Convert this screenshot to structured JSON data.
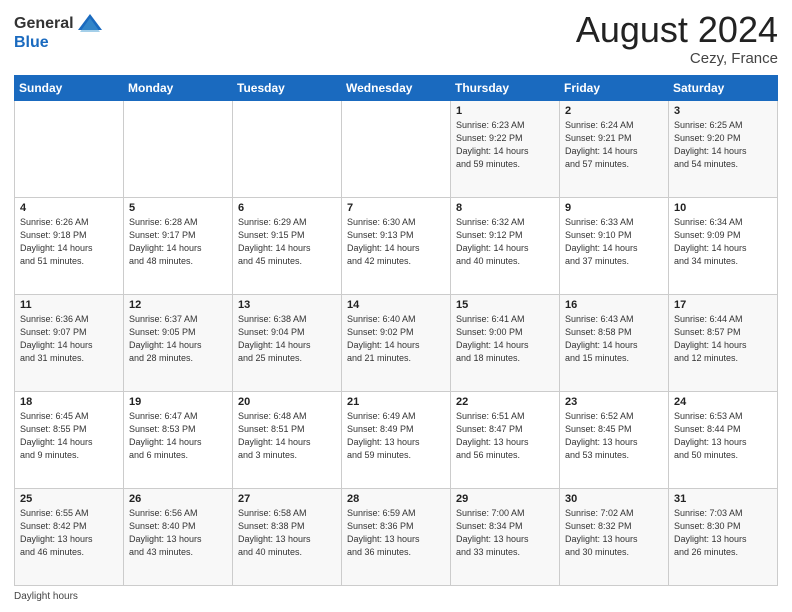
{
  "header": {
    "logo_general": "General",
    "logo_blue": "Blue",
    "month_year": "August 2024",
    "location": "Cezy, France"
  },
  "footer": {
    "daylight_label": "Daylight hours"
  },
  "weekdays": [
    "Sunday",
    "Monday",
    "Tuesday",
    "Wednesday",
    "Thursday",
    "Friday",
    "Saturday"
  ],
  "weeks": [
    [
      {
        "day": "",
        "info": ""
      },
      {
        "day": "",
        "info": ""
      },
      {
        "day": "",
        "info": ""
      },
      {
        "day": "",
        "info": ""
      },
      {
        "day": "1",
        "info": "Sunrise: 6:23 AM\nSunset: 9:22 PM\nDaylight: 14 hours\nand 59 minutes."
      },
      {
        "day": "2",
        "info": "Sunrise: 6:24 AM\nSunset: 9:21 PM\nDaylight: 14 hours\nand 57 minutes."
      },
      {
        "day": "3",
        "info": "Sunrise: 6:25 AM\nSunset: 9:20 PM\nDaylight: 14 hours\nand 54 minutes."
      }
    ],
    [
      {
        "day": "4",
        "info": "Sunrise: 6:26 AM\nSunset: 9:18 PM\nDaylight: 14 hours\nand 51 minutes."
      },
      {
        "day": "5",
        "info": "Sunrise: 6:28 AM\nSunset: 9:17 PM\nDaylight: 14 hours\nand 48 minutes."
      },
      {
        "day": "6",
        "info": "Sunrise: 6:29 AM\nSunset: 9:15 PM\nDaylight: 14 hours\nand 45 minutes."
      },
      {
        "day": "7",
        "info": "Sunrise: 6:30 AM\nSunset: 9:13 PM\nDaylight: 14 hours\nand 42 minutes."
      },
      {
        "day": "8",
        "info": "Sunrise: 6:32 AM\nSunset: 9:12 PM\nDaylight: 14 hours\nand 40 minutes."
      },
      {
        "day": "9",
        "info": "Sunrise: 6:33 AM\nSunset: 9:10 PM\nDaylight: 14 hours\nand 37 minutes."
      },
      {
        "day": "10",
        "info": "Sunrise: 6:34 AM\nSunset: 9:09 PM\nDaylight: 14 hours\nand 34 minutes."
      }
    ],
    [
      {
        "day": "11",
        "info": "Sunrise: 6:36 AM\nSunset: 9:07 PM\nDaylight: 14 hours\nand 31 minutes."
      },
      {
        "day": "12",
        "info": "Sunrise: 6:37 AM\nSunset: 9:05 PM\nDaylight: 14 hours\nand 28 minutes."
      },
      {
        "day": "13",
        "info": "Sunrise: 6:38 AM\nSunset: 9:04 PM\nDaylight: 14 hours\nand 25 minutes."
      },
      {
        "day": "14",
        "info": "Sunrise: 6:40 AM\nSunset: 9:02 PM\nDaylight: 14 hours\nand 21 minutes."
      },
      {
        "day": "15",
        "info": "Sunrise: 6:41 AM\nSunset: 9:00 PM\nDaylight: 14 hours\nand 18 minutes."
      },
      {
        "day": "16",
        "info": "Sunrise: 6:43 AM\nSunset: 8:58 PM\nDaylight: 14 hours\nand 15 minutes."
      },
      {
        "day": "17",
        "info": "Sunrise: 6:44 AM\nSunset: 8:57 PM\nDaylight: 14 hours\nand 12 minutes."
      }
    ],
    [
      {
        "day": "18",
        "info": "Sunrise: 6:45 AM\nSunset: 8:55 PM\nDaylight: 14 hours\nand 9 minutes."
      },
      {
        "day": "19",
        "info": "Sunrise: 6:47 AM\nSunset: 8:53 PM\nDaylight: 14 hours\nand 6 minutes."
      },
      {
        "day": "20",
        "info": "Sunrise: 6:48 AM\nSunset: 8:51 PM\nDaylight: 14 hours\nand 3 minutes."
      },
      {
        "day": "21",
        "info": "Sunrise: 6:49 AM\nSunset: 8:49 PM\nDaylight: 13 hours\nand 59 minutes."
      },
      {
        "day": "22",
        "info": "Sunrise: 6:51 AM\nSunset: 8:47 PM\nDaylight: 13 hours\nand 56 minutes."
      },
      {
        "day": "23",
        "info": "Sunrise: 6:52 AM\nSunset: 8:45 PM\nDaylight: 13 hours\nand 53 minutes."
      },
      {
        "day": "24",
        "info": "Sunrise: 6:53 AM\nSunset: 8:44 PM\nDaylight: 13 hours\nand 50 minutes."
      }
    ],
    [
      {
        "day": "25",
        "info": "Sunrise: 6:55 AM\nSunset: 8:42 PM\nDaylight: 13 hours\nand 46 minutes."
      },
      {
        "day": "26",
        "info": "Sunrise: 6:56 AM\nSunset: 8:40 PM\nDaylight: 13 hours\nand 43 minutes."
      },
      {
        "day": "27",
        "info": "Sunrise: 6:58 AM\nSunset: 8:38 PM\nDaylight: 13 hours\nand 40 minutes."
      },
      {
        "day": "28",
        "info": "Sunrise: 6:59 AM\nSunset: 8:36 PM\nDaylight: 13 hours\nand 36 minutes."
      },
      {
        "day": "29",
        "info": "Sunrise: 7:00 AM\nSunset: 8:34 PM\nDaylight: 13 hours\nand 33 minutes."
      },
      {
        "day": "30",
        "info": "Sunrise: 7:02 AM\nSunset: 8:32 PM\nDaylight: 13 hours\nand 30 minutes."
      },
      {
        "day": "31",
        "info": "Sunrise: 7:03 AM\nSunset: 8:30 PM\nDaylight: 13 hours\nand 26 minutes."
      }
    ]
  ]
}
